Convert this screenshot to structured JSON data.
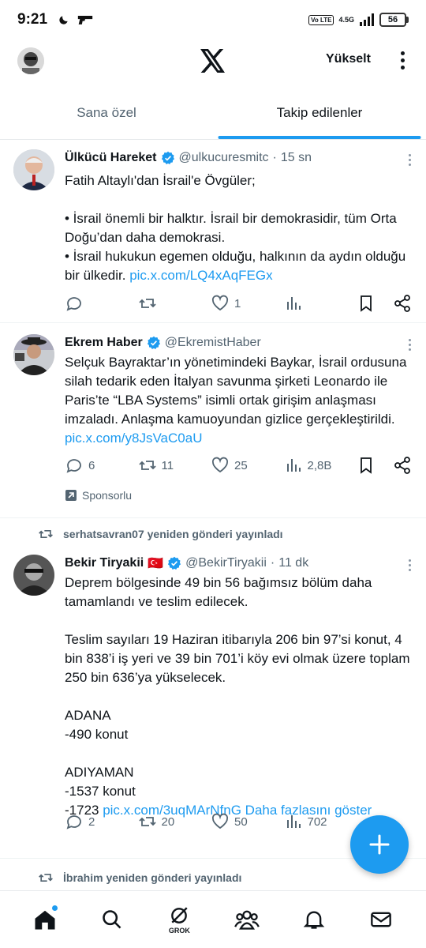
{
  "status": {
    "time": "9:21",
    "volte": "Vo LTE",
    "net": "4.5G",
    "battery": "56"
  },
  "header": {
    "upgrade_label": "Yükselt"
  },
  "tabs": [
    {
      "label": "Sana özel",
      "active": false
    },
    {
      "label": "Takip edilenler",
      "active": true
    }
  ],
  "posts": [
    {
      "name": "Ülkücü Hareket",
      "handle": "@ulkucuresmitc",
      "time": "15 sn",
      "text": "Fatih Altaylı'dan İsrail'e Övgüler;\n\n• İsrail önemli bir halktır. İsrail bir demokrasidir, tüm Orta Doğu’dan daha demokrasi.\n• İsrail hukukun egemen olduğu, halkının da aydın olduğu bir ülkedir. ",
      "link": "pic.x.com/LQ4xAqFEGx",
      "replies": "",
      "reposts": "",
      "likes": "1",
      "views": ""
    },
    {
      "name": "Ekrem Haber",
      "handle": "@EkremistHaber",
      "time": "",
      "text": "Selçuk Bayraktar’ın yönetimindeki Baykar, İsrail ordusuna silah tedarik eden İtalyan savunma şirketi Leonardo ile Paris’te “LBA Systems” isimli ortak girişim anlaşması imzaladı. Anlaşma kamuoyundan gizlice gerçekleştirildi. ",
      "link": "pic.x.com/y8JsVaC0aU",
      "replies": "6",
      "reposts": "11",
      "likes": "25",
      "views": "2,8B",
      "sponsored": "Sponsorlu"
    },
    {
      "repost_by": "serhatsavran07 yeniden gönderi yayınladı",
      "name": "Bekir Tiryakii",
      "flag": "🇹🇷",
      "handle": "@BekirTiryakii",
      "time": "11 dk",
      "text": "Deprem bölgesinde 49 bin 56 bağımsız bölüm daha tamamlandı ve teslim edilecek.\n\nTeslim sayıları 19 Haziran itibarıyla 206 bin 97’si konut, 4 bin 838’i iş yeri ve 39 bin 701’i köy evi olmak üzere toplam 250 bin 636’ya yükselecek.\n\nADANA\n-490 konut\n\nADIYAMAN\n-1537 konut\n-1723 ",
      "link": "pic.x.com/3uqMArNfnG",
      "show_more": "Daha fazlasını göster",
      "replies": "2",
      "reposts": "20",
      "likes": "50",
      "views": "702"
    }
  ],
  "next_repost": "İbrahim yeniden gönderi yayınladı",
  "bottom_nav": {
    "grok_label": "GROK"
  },
  "colors": {
    "accent": "#1d9bf0",
    "text": "#0f1419",
    "muted": "#536471"
  },
  "icons": [
    "home-icon",
    "search-icon",
    "grok-icon",
    "communities-icon",
    "bell-icon",
    "mail-icon"
  ]
}
